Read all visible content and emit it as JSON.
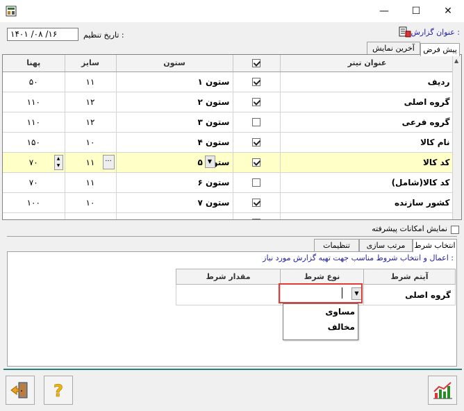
{
  "window": {
    "minimize": "—",
    "maximize": "☐",
    "close": "✕"
  },
  "header": {
    "report_title_label": "عنوان گزارش :",
    "date_label": "تاریخ تنظیم :",
    "date_value": "۱۴۰۱ /۰۸ /۱۶"
  },
  "top_tabs": [
    "پیش فرض",
    "آخرین نمایش"
  ],
  "grid": {
    "headers": {
      "title": "عنوان تیتر",
      "check": "",
      "column": "ستون",
      "size": "سایز",
      "width": "پهنا"
    },
    "rows": [
      {
        "title": "ردیف",
        "checked": true,
        "column": "ستون ۱",
        "size": "۱۱",
        "width": "۵۰"
      },
      {
        "title": "گروه اصلی",
        "checked": true,
        "column": "ستون ۲",
        "size": "۱۲",
        "width": "۱۱۰"
      },
      {
        "title": "گروه فرعی",
        "checked": false,
        "column": "ستون ۳",
        "size": "۱۲",
        "width": "۱۱۰"
      },
      {
        "title": "نام کالا",
        "checked": true,
        "column": "ستون ۴",
        "size": "۱۰",
        "width": "۱۵۰"
      },
      {
        "title": "کد کالا",
        "checked": true,
        "column": "ستون ۵",
        "size": "۱۱",
        "width": "۷۰",
        "selected": true
      },
      {
        "title": "کد کالا(شامل)",
        "checked": false,
        "column": "ستون ۶",
        "size": "۱۱",
        "width": "۷۰"
      },
      {
        "title": "کشور سازنده",
        "checked": true,
        "column": "ستون ۷",
        "size": "۱۰",
        "width": "۱۰۰"
      }
    ]
  },
  "advanced_checkbox_label": "نمایش امکانات پیشرفته",
  "lower_tabs": [
    "انتخاب شرط",
    "مرتب سازی",
    "تنظیمات"
  ],
  "condition": {
    "hint": "اعمال و انتخاب شروط مناسب جهت تهیه گزارش  مورد نیاز :",
    "headers": {
      "item": "آیتم شرط",
      "type": "نوع شرط",
      "value": "مقدار شرط"
    },
    "row": {
      "item": "گروه اصلی",
      "type": "",
      "value": ""
    },
    "dropdown_options": [
      "مساوی",
      "مخالف"
    ]
  },
  "icons": {
    "exit": "exit-door-icon",
    "help": "help-question-icon",
    "chart": "bar-chart-icon",
    "report": "report-icon"
  },
  "colors": {
    "selected_row": "#ffffc8",
    "hint_text": "#1c1ca8",
    "highlight": "#e53935",
    "teal_line": "#2e7d7d"
  }
}
